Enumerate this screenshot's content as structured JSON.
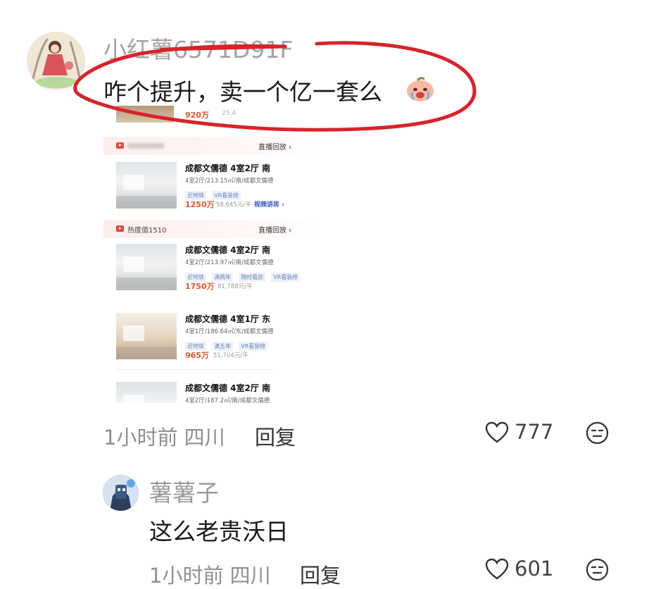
{
  "comments": [
    {
      "username": "小红薯6571D91F",
      "text": "咋个提升，卖一个亿一套么",
      "emoji": "crying-peach-emoji",
      "time": "1小时前",
      "location": "四川",
      "reply_label": "回复",
      "likes": "777"
    },
    {
      "username": "薯薯子",
      "text": "这么老贵沃日",
      "time": "1小时前",
      "location": "四川",
      "reply_label": "回复",
      "likes": "601"
    }
  ],
  "listing_screenshot": {
    "partial_top": {
      "price": "920万",
      "unit_price": "25,4"
    },
    "cards": [
      {
        "header": {
          "heat": "",
          "replay": "直播回放 ›"
        },
        "title": "成都文儒德 4室2厅 南",
        "desc": "4室2厅/213.15㎡/南/成都文儒德",
        "tags": [
          "近地铁",
          "VR看装修"
        ],
        "price": "1250万",
        "unit_price": "58,645元/平",
        "video_link": "视频讲房 ›"
      },
      {
        "header": {
          "heat": "热度值1510",
          "replay": "直播回放 ›"
        },
        "title": "成都文儒德 4室2厅 南",
        "desc": "4室2厅/213.97㎡/南/成都文儒德",
        "tags": [
          "近地铁",
          "满两年",
          "随时看房",
          "VR看装修"
        ],
        "price": "1750万",
        "unit_price": "81,788元/平",
        "video_link": ""
      },
      {
        "header": null,
        "title": "成都文儒德 4室1厅 东",
        "desc": "4室1厅/186.64㎡/东/成都文儒德",
        "tags": [
          "近地铁",
          "满五年",
          "VR看装修"
        ],
        "price": "965万",
        "unit_price": "51,704元/平",
        "video_link": ""
      },
      {
        "header": null,
        "title": "成都文儒德 4室2厅 南",
        "desc": "4室2厅/187.2㎡/南/成都文儒德",
        "tags": [],
        "price": "",
        "unit_price": "",
        "video_link": ""
      }
    ]
  },
  "colors": {
    "scribble_red": "#d8232a",
    "price_orange": "#e25424",
    "username_gray": "#a3a3a3",
    "time_gray": "#8f8f8f"
  },
  "icons": {
    "like": "heart-outline-icon",
    "reaction": "neutral-face-icon"
  }
}
